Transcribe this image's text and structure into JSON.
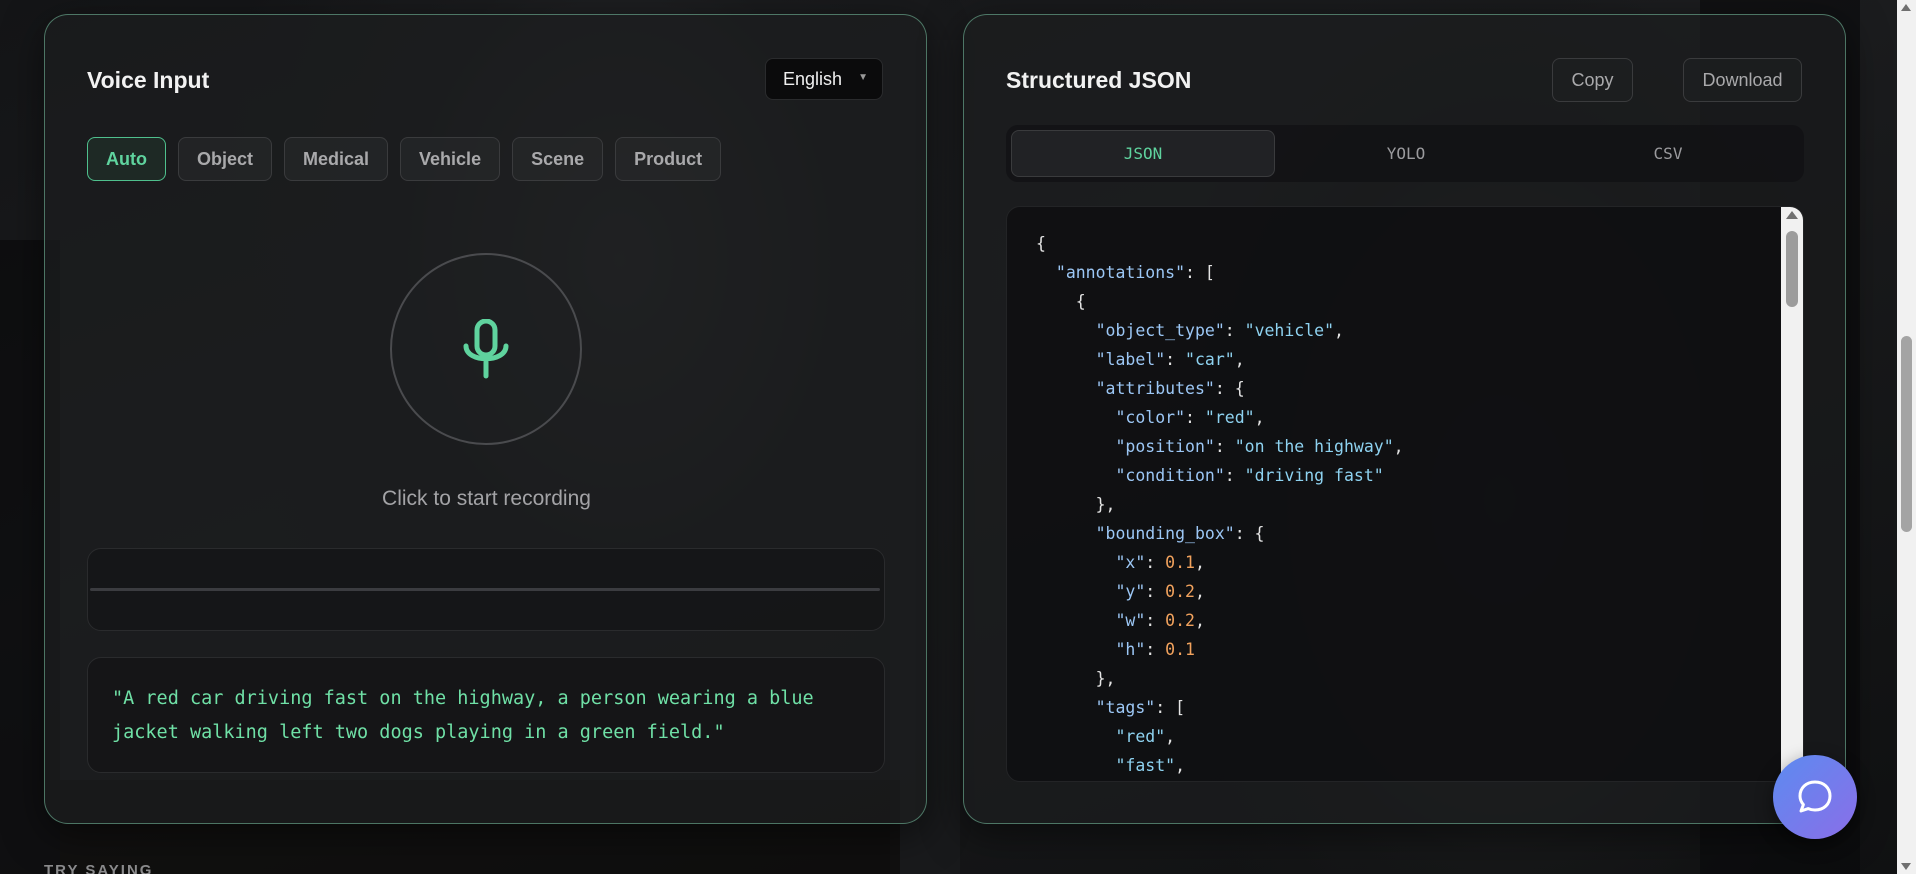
{
  "voice_panel": {
    "title": "Voice Input",
    "language": "English",
    "modes": [
      {
        "label": "Auto",
        "active": true
      },
      {
        "label": "Object",
        "active": false
      },
      {
        "label": "Medical",
        "active": false
      },
      {
        "label": "Vehicle",
        "active": false
      },
      {
        "label": "Scene",
        "active": false
      },
      {
        "label": "Product",
        "active": false
      }
    ],
    "record_hint": "Click to start recording",
    "transcript": "\"A red car driving fast on the highway, a person wearing a blue jacket walking left two dogs playing in a green field.\""
  },
  "json_panel": {
    "title": "Structured JSON",
    "copy_label": "Copy",
    "download_label": "Download",
    "tabs": [
      {
        "label": "JSON",
        "active": true
      },
      {
        "label": "YOLO",
        "active": false
      },
      {
        "label": "CSV",
        "active": false
      }
    ],
    "code": {
      "annotations_key": "annotations",
      "object_type": "vehicle",
      "label": "car",
      "color": "red",
      "position": "on the highway",
      "condition": "driving fast",
      "bbox": {
        "x": "0.1",
        "y": "0.2",
        "w": "0.2",
        "h": "0.1"
      },
      "tags": [
        "red",
        "fast"
      ]
    }
  },
  "footer": {
    "try_saying": "TRY SAYING"
  },
  "icons": {
    "mic": "microphone-icon",
    "chat": "chat-bubble-icon",
    "caret": "chevron-down-icon"
  },
  "colors": {
    "accent": "#5fd39e",
    "panel_border": "#8ce6be",
    "chat_gradient_start": "#5c8bf0",
    "chat_gradient_end": "#8a6ee8",
    "json_number": "#f1a25d",
    "json_string": "#8ed2f0"
  }
}
